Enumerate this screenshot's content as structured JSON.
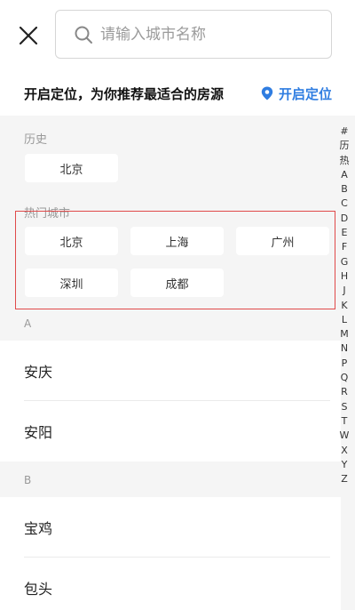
{
  "search": {
    "placeholder": "请输入城市名称"
  },
  "location": {
    "tip": "开启定位，为你推荐最适合的房源",
    "button_label": "开启定位"
  },
  "history": {
    "title": "历史",
    "cities": [
      "北京"
    ]
  },
  "hot": {
    "title": "热门城市",
    "cities": [
      "北京",
      "上海",
      "广州",
      "深圳",
      "成都"
    ]
  },
  "groups": [
    {
      "letter": "A",
      "cities": [
        "安庆",
        "安阳"
      ]
    },
    {
      "letter": "B",
      "cities": [
        "宝鸡",
        "包头"
      ]
    }
  ],
  "index_letters": [
    "#",
    "历",
    "热",
    "A",
    "B",
    "C",
    "D",
    "E",
    "F",
    "G",
    "H",
    "J",
    "K",
    "L",
    "M",
    "N",
    "P",
    "Q",
    "R",
    "S",
    "T",
    "W",
    "X",
    "Y",
    "Z"
  ],
  "colors": {
    "accent": "#2f7de1",
    "highlight_border": "#e04a4a",
    "background": "#f5f5f5"
  }
}
